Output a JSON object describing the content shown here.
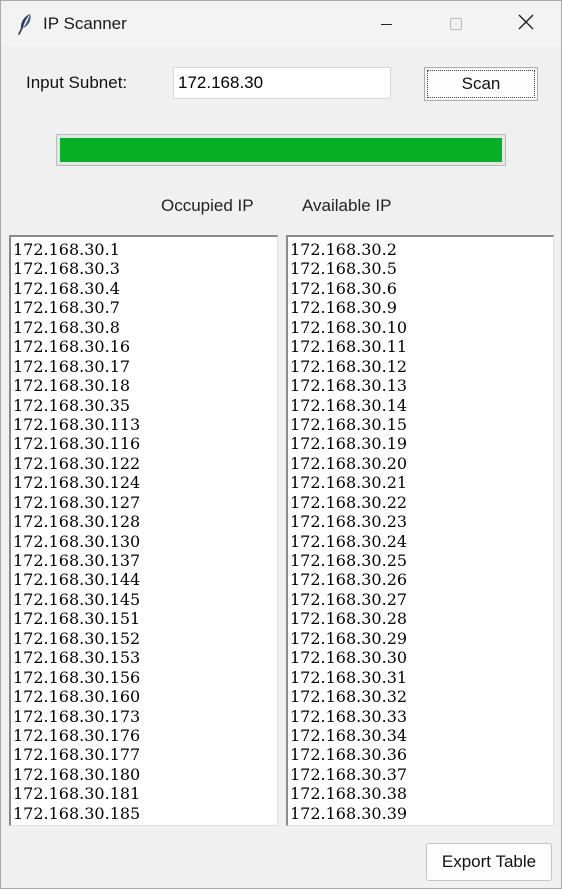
{
  "window": {
    "title": "IP Scanner",
    "icon": "feather-icon"
  },
  "form": {
    "subnet_label": "Input Subnet:",
    "subnet_value": "172.168.30",
    "scan_label": "Scan"
  },
  "progress": {
    "fraction": 1.0,
    "color": "#06b025"
  },
  "columns": {
    "occupied_header": "Occupied IP",
    "available_header": "Available IP"
  },
  "occupied_ips": [
    "172.168.30.1",
    "172.168.30.3",
    "172.168.30.4",
    "172.168.30.7",
    "172.168.30.8",
    "172.168.30.16",
    "172.168.30.17",
    "172.168.30.18",
    "172.168.30.35",
    "172.168.30.113",
    "172.168.30.116",
    "172.168.30.122",
    "172.168.30.124",
    "172.168.30.127",
    "172.168.30.128",
    "172.168.30.130",
    "172.168.30.137",
    "172.168.30.144",
    "172.168.30.145",
    "172.168.30.151",
    "172.168.30.152",
    "172.168.30.153",
    "172.168.30.156",
    "172.168.30.160",
    "172.168.30.173",
    "172.168.30.176",
    "172.168.30.177",
    "172.168.30.180",
    "172.168.30.181",
    "172.168.30.185"
  ],
  "available_ips": [
    "172.168.30.2",
    "172.168.30.5",
    "172.168.30.6",
    "172.168.30.9",
    "172.168.30.10",
    "172.168.30.11",
    "172.168.30.12",
    "172.168.30.13",
    "172.168.30.14",
    "172.168.30.15",
    "172.168.30.19",
    "172.168.30.20",
    "172.168.30.21",
    "172.168.30.22",
    "172.168.30.23",
    "172.168.30.24",
    "172.168.30.25",
    "172.168.30.26",
    "172.168.30.27",
    "172.168.30.28",
    "172.168.30.29",
    "172.168.30.30",
    "172.168.30.31",
    "172.168.30.32",
    "172.168.30.33",
    "172.168.30.34",
    "172.168.30.36",
    "172.168.30.37",
    "172.168.30.38",
    "172.168.30.39"
  ],
  "footer": {
    "export_label": "Export Table"
  }
}
